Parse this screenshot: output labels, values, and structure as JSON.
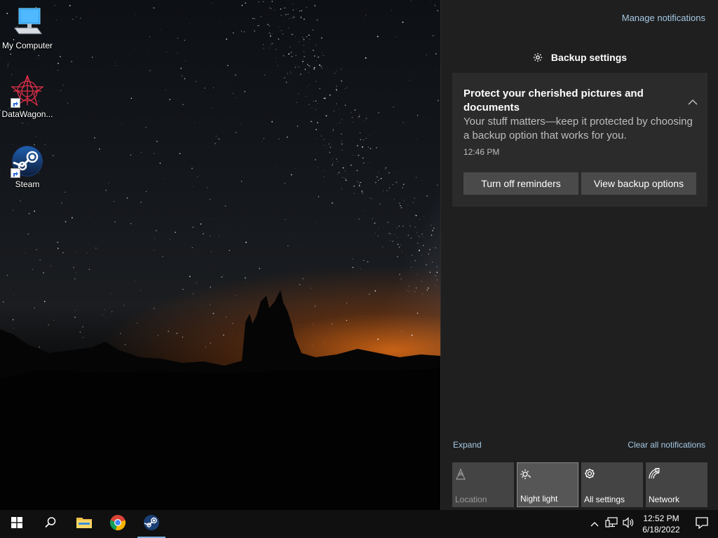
{
  "desktop": {
    "icons": [
      {
        "label": "My Computer",
        "icon": "computer-icon"
      },
      {
        "label": "DataWagon...",
        "icon": "datawagon-icon"
      },
      {
        "label": "Steam",
        "icon": "steam-icon"
      }
    ]
  },
  "action_center": {
    "manage_notifications": "Manage notifications",
    "group_header": {
      "icon": "gear-icon",
      "label": "Backup settings"
    },
    "notification": {
      "title": "Protect your cherished pictures and documents",
      "body": "Your stuff matters—keep it protected by choosing a backup option that works for you.",
      "time": "12:46 PM",
      "buttons": {
        "turn_off": "Turn off reminders",
        "view_options": "View backup options"
      }
    },
    "expand": "Expand",
    "clear_all": "Clear all notifications",
    "quick_actions": [
      {
        "label": "Location",
        "icon": "location-icon",
        "state": "disabled"
      },
      {
        "label": "Night light",
        "icon": "night-light-icon",
        "state": "selected"
      },
      {
        "label": "All settings",
        "icon": "gear-icon",
        "state": "normal"
      },
      {
        "label": "Network",
        "icon": "network-icon",
        "state": "normal"
      }
    ]
  },
  "taskbar": {
    "apps": [
      "start-icon",
      "search-icon",
      "file-explorer-icon",
      "chrome-icon",
      "steam-icon"
    ],
    "clock": {
      "time": "12:52 PM",
      "date": "6/18/2022"
    }
  },
  "colors": {
    "link": "#a5c8e4",
    "panel": "#1f1f1f",
    "card": "#2b2b2b",
    "taskbar": "#101010"
  }
}
